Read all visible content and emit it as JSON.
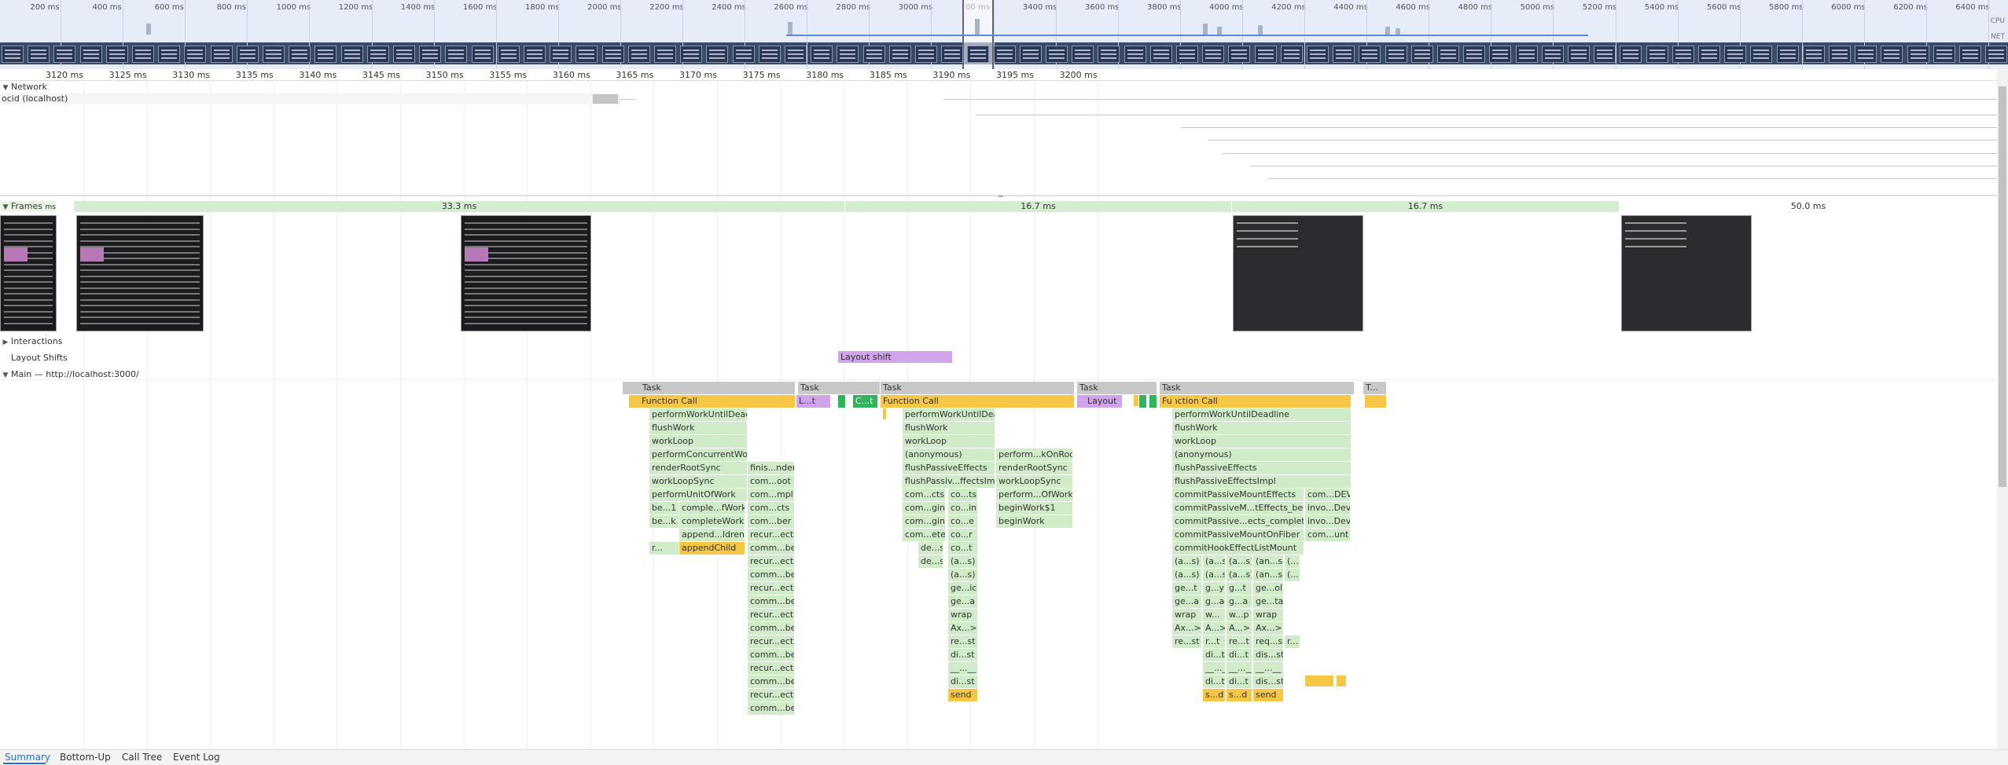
{
  "overview": {
    "ticks": [
      "200 ms",
      "400 ms",
      "600 ms",
      "800 ms",
      "1000 ms",
      "1200 ms",
      "1400 ms",
      "1600 ms",
      "1800 ms",
      "2000 ms",
      "2200 ms",
      "2400 ms",
      "2600 ms",
      "2800 ms",
      "3000 ms",
      "00 ms",
      "3400 ms",
      "3600 ms",
      "3800 ms",
      "4000 ms",
      "4200 ms",
      "4400 ms",
      "4600 ms",
      "4800 ms",
      "5000 ms",
      "5200 ms",
      "5400 ms",
      "5600 ms",
      "5800 ms",
      "6000 ms",
      "6200 ms",
      "6400 ms"
    ],
    "cpu_label": "CPU",
    "net_label": "NET"
  },
  "ruler": {
    "ticks": [
      "3120 ms",
      "3125 ms",
      "3130 ms",
      "3135 ms",
      "3140 ms",
      "3145 ms",
      "3150 ms",
      "3155 ms",
      "3160 ms",
      "3165 ms",
      "3170 ms",
      "3175 ms",
      "3180 ms",
      "3185 ms",
      "3190 ms",
      "3195 ms",
      "3200 ms"
    ]
  },
  "tracks": {
    "network": "Network",
    "network_item": "ocid (localhost)",
    "frames": "Frames",
    "frames_suffix": "ms",
    "interactions": "Interactions",
    "layout_shifts": "Layout Shifts",
    "layout_shift_label": "Layout shift",
    "main": "Main — http://localhost:3000/"
  },
  "frames": [
    "33.3 ms",
    "16.7 ms",
    "16.7 ms",
    "50.0 ms"
  ],
  "flame": {
    "task": "Task",
    "task_short": "T...",
    "function_call": "Function Call",
    "layout": "Layout",
    "small1": "L...t",
    "small2": "C...t",
    "col1": [
      "performWorkUntilDeadline",
      "flushWork",
      "workLoop",
      "performConcurrentWorkOnRoot",
      "renderRootSync",
      "workLoopSync",
      "performUnitOfWork"
    ],
    "col1_pairs": [
      [
        "be...1",
        "comple...fWork"
      ],
      [
        "be...k",
        "completeWork"
      ],
      [
        "",
        "append...ldren"
      ],
      [
        "r...",
        "appendChild"
      ]
    ],
    "col1_right": [
      "finis...nder",
      "com...oot",
      "com...mpl",
      "com...cts",
      "com...ber",
      "recur...ects",
      "comm...ber",
      "recur...ects",
      "comm...ber",
      "recur...ects",
      "comm...ber",
      "recur...ects",
      "comm...ber",
      "recur...ects",
      "comm...ber",
      "recur...ects",
      "comm...ber",
      "recur...ects",
      "comm...ber"
    ],
    "col2": [
      "performWorkUntilDeadline",
      "flushWork",
      "workLoop",
      "(anonymous)",
      "flushPassiveEffects",
      "flushPassiv...ffectsImpl",
      "com...cts",
      "com...gin",
      "com...gin",
      "com...ete",
      "de...s",
      "de...s"
    ],
    "col2_mid": [
      "co...ts",
      "co...in",
      "co...e",
      "co...r",
      "co...t",
      "(a...s)",
      "(a...s)",
      "ge...ic",
      "ge...a",
      "wrap",
      "Ax...>",
      "re...st",
      "di...st",
      "__...__",
      "di...st",
      "send"
    ],
    "col2_right": [
      "perform...kOnRoot",
      "renderRootSync",
      "workLoopSync",
      "perform...OfWork",
      "beginWork$1",
      "beginWork"
    ],
    "col3": [
      "performWorkUntilDeadline",
      "flushWork",
      "workLoop",
      "(anonymous)",
      "flushPassiveEffects",
      "flushPassiveEffectsImpl",
      "commitPassiveMountEffects",
      "commitPassiveM...tEffects_begin",
      "commitPassive...ects_complete",
      "commitPassiveMountOnFiber",
      "commitHookEffectListMount"
    ],
    "col3_right": [
      "com...DEV",
      "invo...Dev",
      "invo...Dev",
      "com...unt"
    ],
    "col3_grid": [
      [
        "(a...s)",
        "(a...s)",
        "(a...s)",
        "(an...s)",
        "(..."
      ],
      [
        "(a...s)",
        "(a...s)",
        "(a...s)",
        "(an...s)",
        "(..."
      ],
      [
        "ge...t",
        "g...y",
        "g...t",
        "ge...ol",
        ""
      ],
      [
        "ge...a",
        "g...a",
        "g...a",
        "ge...ta",
        ""
      ],
      [
        "wrap",
        "w...",
        "w...p",
        "wrap",
        ""
      ],
      [
        "Ax...>",
        "A...>",
        "A...>",
        "Ax...>",
        ""
      ],
      [
        "re...st",
        "r...t",
        "re...t",
        "req...st",
        "r..."
      ],
      [
        "",
        "di...t",
        "di...t",
        "dis...st",
        ""
      ],
      [
        "",
        "__...__",
        "__...__",
        "__...__",
        ""
      ],
      [
        "",
        "di...t",
        "di...t",
        "dis...st",
        ""
      ],
      [
        "",
        "s...d",
        "s...d",
        "send",
        ""
      ]
    ]
  },
  "tabs": [
    "Summary",
    "Bottom-Up",
    "Call Tree",
    "Event Log"
  ]
}
